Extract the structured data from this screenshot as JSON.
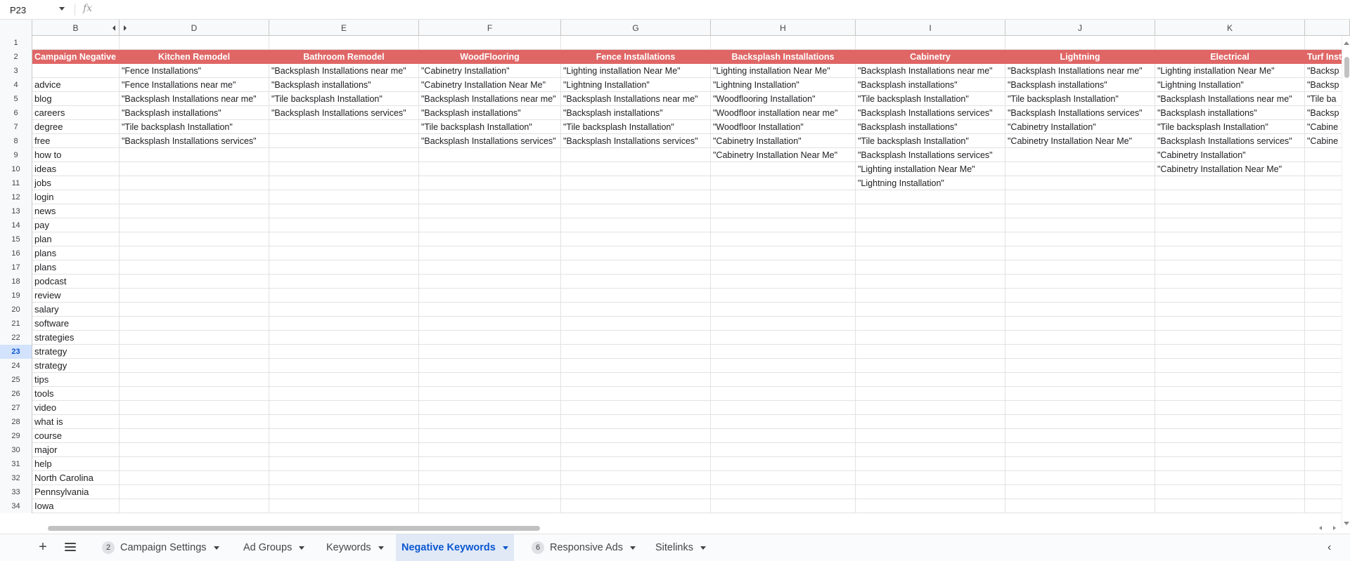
{
  "formula_bar": {
    "name_box": "P23",
    "fx_label": "fx",
    "formula_value": ""
  },
  "column_headers": [
    "B",
    "D",
    "E",
    "F",
    "G",
    "H",
    "I",
    "J",
    "K"
  ],
  "row_numbers": [
    "1",
    "2",
    "3",
    "4",
    "5",
    "6",
    "7",
    "8",
    "9",
    "10",
    "11",
    "12",
    "13",
    "14",
    "15",
    "16",
    "17",
    "18",
    "19",
    "20",
    "21",
    "22",
    "23",
    "24",
    "25",
    "26",
    "27",
    "28",
    "29",
    "30",
    "31",
    "32",
    "33",
    "34"
  ],
  "active_row": "23",
  "header_row": [
    "Campaign Negative",
    "Kitchen Remodel",
    "Bathroom Remodel",
    "WoodFlooring",
    "Fence Installations",
    "Backsplash Installations",
    "Cabinetry",
    "Lightning",
    "Electrical",
    "Turf Inst"
  ],
  "campaign_negatives": [
    "",
    "advice",
    "blog",
    "careers",
    "degree",
    "free",
    "how to",
    "ideas",
    "jobs",
    "login",
    "news",
    "pay",
    "plan",
    "plans",
    "plans",
    "podcast",
    "review",
    "salary",
    "software",
    "strategies",
    "strategy",
    "strategy",
    "tips",
    "tools",
    "video",
    "what is",
    "course",
    "major",
    "help",
    "North Carolina",
    "Pennsylvania",
    "Iowa"
  ],
  "ad_group_columns": [
    [
      "\"Fence Installations\"",
      "\"Fence Installations near me\"",
      "\"Backsplash Installations near me\"",
      "\"Backsplash installations\"",
      "\"Tile backsplash Installation\"",
      "\"Backsplash Installations services\""
    ],
    [
      "\"Backsplash Installations near me\"",
      "\"Backsplash installations\"",
      "\"Tile backsplash Installation\"",
      "\"Backsplash Installations services\""
    ],
    [
      "\"Cabinetry Installation\"",
      "\"Cabinetry Installation Near Me\"",
      "\"Backsplash Installations near me\"",
      "\"Backsplash installations\"",
      "\"Tile backsplash Installation\"",
      "\"Backsplash Installations services\""
    ],
    [
      "\"Lighting installation Near Me\"",
      "\"Lightning Installation\"",
      "\"Backsplash Installations near me\"",
      "\"Backsplash installations\"",
      "\"Tile backsplash Installation\"",
      "\"Backsplash Installations services\""
    ],
    [
      "\"Lighting installation Near Me\"",
      "\"Lightning Installation\"",
      "\"Woodflooring Installation\"",
      "\"Woodfloor installation near me\"",
      "\"Woodfloor Installation\"",
      "\"Cabinetry Installation\"",
      "\"Cabinetry Installation Near Me\""
    ],
    [
      "\"Backsplash Installations near me\"",
      "\"Backsplash installations\"",
      "\"Tile backsplash Installation\"",
      "\"Backsplash Installations services\"",
      "\"Backsplash installations\"",
      "\"Tile backsplash Installation\"",
      "\"Backsplash Installations services\"",
      "\"Lighting installation Near Me\"",
      "\"Lightning Installation\""
    ],
    [
      "\"Backsplash Installations near me\"",
      "\"Backsplash installations\"",
      "\"Tile backsplash Installation\"",
      "\"Backsplash Installations services\"",
      "\"Cabinetry Installation\"",
      "\"Cabinetry Installation Near Me\""
    ],
    [
      "\"Lighting installation Near Me\"",
      "\"Lightning Installation\"",
      "\"Backsplash Installations near me\"",
      "\"Backsplash installations\"",
      "\"Tile backsplash Installation\"",
      "\"Backsplash Installations services\"",
      "\"Cabinetry Installation\"",
      "\"Cabinetry Installation Near Me\""
    ],
    [
      "\"Backsp",
      "\"Backsp",
      "\"Tile ba",
      "\"Backsp",
      "\"Cabine",
      "\"Cabine"
    ]
  ],
  "tabs": [
    {
      "label": "Campaign Settings",
      "badge": "2"
    },
    {
      "label": "Ad Groups",
      "badge": ""
    },
    {
      "label": "Keywords",
      "badge": ""
    },
    {
      "label": "Negative Keywords",
      "badge": "",
      "active": true
    },
    {
      "label": "Responsive Ads",
      "badge": "6"
    },
    {
      "label": "Sitelinks",
      "badge": ""
    }
  ],
  "colors": {
    "header_fill": "#e06666",
    "header_text": "#ffffff",
    "active_tab": "#0b57d0"
  }
}
